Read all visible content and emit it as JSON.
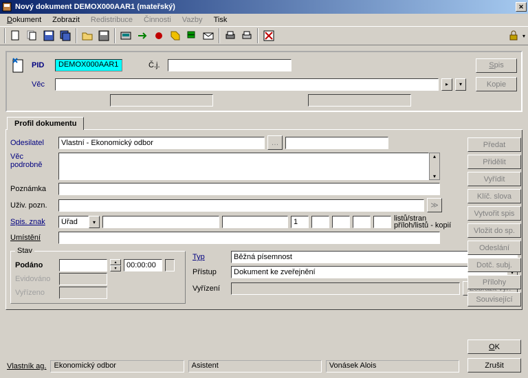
{
  "window": {
    "title": "Nový dokument DEMOX000AAR1 (mateřský)"
  },
  "menu": {
    "dokument": "Dokument",
    "zobrazit": "Zobrazit",
    "redistribuce": "Redistribuce",
    "cinnosti": "Činnosti",
    "vazby": "Vazby",
    "tisk": "Tisk"
  },
  "header": {
    "pid_label": "PID",
    "pid_value": "DEMOX000AAR1",
    "cj_label": "Č.j.",
    "cj_value": "",
    "vec_label": "Věc",
    "vec_value": "",
    "spis_btn": "Spis",
    "kopie_btn": "Kopie"
  },
  "tab": {
    "profil": "Profil dokumentu"
  },
  "form": {
    "odesilatel_label": "Odesilatel",
    "odesilatel_value": "Vlastní - Ekonomický odbor",
    "vec_podrobne_label": "Věc podrobně",
    "vec_podrobne_value": "",
    "poznamka_label": "Poznámka",
    "poznamka_value": "",
    "uzivpozn_label": "Uživ. pozn.",
    "uzivpozn_value": "",
    "spisznak_label": "Spis. znak",
    "spisznak_select": "Úřad",
    "listu_value": "1",
    "listu_label": "listů/stran",
    "priloh_label": "příloh/listů - kopií",
    "umisteni_label": "Umístění",
    "umisteni_value": "",
    "stav_legend": "Stav",
    "podano_label": "Podáno",
    "podano_time": "00:00:00",
    "evidovano_label": "Evidováno",
    "vyrizeno_label": "Vyřízeno",
    "typ_label": "Typ",
    "typ_value": "Běžná písemnost",
    "pristup_label": "Přístup",
    "pristup_value": "Dokument ke zveřejnění",
    "vyrizeni_label": "Vyřízení",
    "vyrizeni_value": "",
    "zobrazit_vyr_btn": "Zobrazit vyř."
  },
  "sidebar": {
    "predat": "Předat",
    "pridelit": "Přidělit",
    "vyridit": "Vyřídit",
    "klic_slova": "Klíč. slova",
    "vytvorit_spis": "Vytvořit spis",
    "vlozit_do_sp": "Vložit do sp.",
    "odeslani": "Odeslání",
    "dotc_subj": "Dotč. subj.",
    "prilohy": "Přílohy",
    "souvisejici": "Související"
  },
  "footer": {
    "vlastnik_label": "Vlastník ag.",
    "vlastnik_value": "Ekonomický odbor",
    "role_value": "Asistent",
    "user_value": "Vonásek Alois"
  },
  "okcancel": {
    "ok": "OK",
    "zrusit": "Zrušit"
  }
}
